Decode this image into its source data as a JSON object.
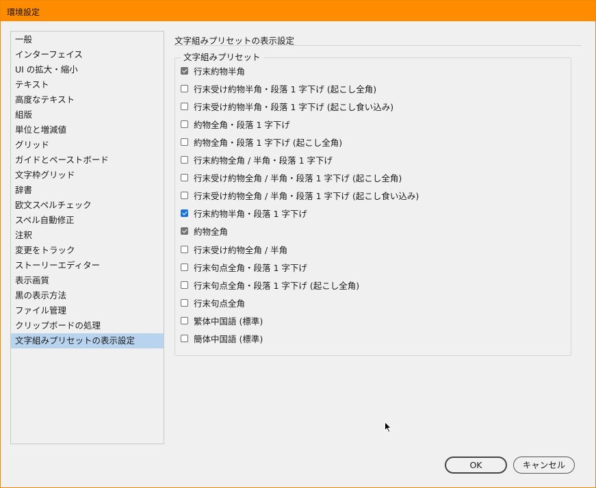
{
  "window": {
    "title": "環境設定"
  },
  "sidebar": {
    "items": [
      "一般",
      "インターフェイス",
      "UI の拡大・縮小",
      "テキスト",
      "高度なテキスト",
      "組版",
      "単位と増減値",
      "グリッド",
      "ガイドとペーストボード",
      "文字枠グリッド",
      "辞書",
      "欧文スペルチェック",
      "スペル自動修正",
      "注釈",
      "変更をトラック",
      "ストーリーエディター",
      "表示画質",
      "黒の表示方法",
      "ファイル管理",
      "クリップボードの処理",
      "文字組みプリセットの表示設定"
    ],
    "selected_index": 20
  },
  "main": {
    "header": "文字組みプリセットの表示設定",
    "group_label": "文字組みプリセット",
    "options": [
      {
        "label": "行末約物半角",
        "checked": true,
        "style": "gray"
      },
      {
        "label": "行末受け約物半角・段落 1 字下げ (起こし全角)",
        "checked": false
      },
      {
        "label": "行末受け約物半角・段落 1 字下げ (起こし食い込み)",
        "checked": false
      },
      {
        "label": "約物全角・段落 1 字下げ",
        "checked": false
      },
      {
        "label": "約物全角・段落 1 字下げ (起こし全角)",
        "checked": false
      },
      {
        "label": "行末約物全角 / 半角・段落 1 字下げ",
        "checked": false
      },
      {
        "label": "行末受け約物全角 / 半角・段落 1 字下げ (起こし全角)",
        "checked": false
      },
      {
        "label": "行末受け約物全角 / 半角・段落 1 字下げ (起こし食い込み)",
        "checked": false
      },
      {
        "label": "行末約物半角・段落 1 字下げ",
        "checked": true,
        "style": "blue"
      },
      {
        "label": "約物全角",
        "checked": true,
        "style": "gray"
      },
      {
        "label": "行末受け約物全角 / 半角",
        "checked": false
      },
      {
        "label": "行末句点全角・段落 1 字下げ",
        "checked": false
      },
      {
        "label": "行末句点全角・段落 1 字下げ (起こし全角)",
        "checked": false
      },
      {
        "label": "行末句点全角",
        "checked": false
      },
      {
        "label": "繁体中国語 (標準)",
        "checked": false
      },
      {
        "label": "簡体中国語 (標準)",
        "checked": false
      }
    ]
  },
  "buttons": {
    "ok": "OK",
    "cancel": "キャンセル"
  },
  "colors": {
    "titlebar": "#ff8c00",
    "selected_item": "#b8d3ee",
    "checkbox_blue": "#1a73d9",
    "checkbox_gray": "#747474"
  }
}
